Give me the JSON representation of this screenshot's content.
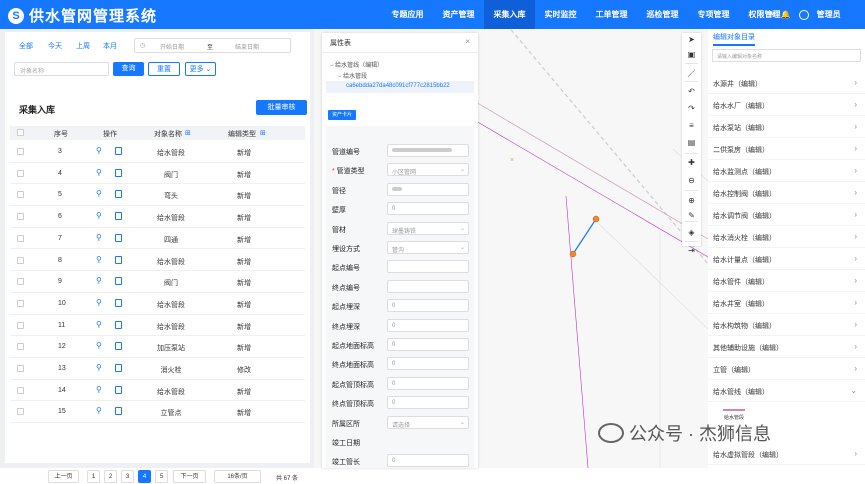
{
  "app": {
    "title": "供水管网管理系统",
    "logo_letter": "S"
  },
  "nav": {
    "items": [
      "专题应用",
      "资产管理",
      "采集入库",
      "实时监控",
      "工单管理",
      "巡检管理",
      "专项管理",
      "权限管理"
    ],
    "active": "采集入库"
  },
  "header": {
    "user": "管理员",
    "bell": "🔔",
    "mail": "✉"
  },
  "filter": {
    "quick": [
      "全部",
      "今天",
      "上周",
      "本月"
    ],
    "date_start_placeholder": "开始日期",
    "date_sep": "至",
    "date_end_placeholder": "结束日期",
    "name_placeholder": "对象名称",
    "search_btn": "查询",
    "reset_btn": "重置",
    "more_btn": "更多"
  },
  "list": {
    "title": "采集入库",
    "batch_btn": "批量审核",
    "headers": [
      "序号",
      "操作",
      "对象名称",
      "编辑类型"
    ],
    "rows": [
      {
        "no": "3",
        "name": "给水管段",
        "type": "新增"
      },
      {
        "no": "4",
        "name": "阀门",
        "type": "新增"
      },
      {
        "no": "5",
        "name": "弯头",
        "type": "新增"
      },
      {
        "no": "6",
        "name": "给水管段",
        "type": "新增"
      },
      {
        "no": "7",
        "name": "四通",
        "type": "新增"
      },
      {
        "no": "8",
        "name": "给水管段",
        "type": "新增"
      },
      {
        "no": "9",
        "name": "阀门",
        "type": "新增"
      },
      {
        "no": "10",
        "name": "给水管段",
        "type": "新增"
      },
      {
        "no": "11",
        "name": "给水管段",
        "type": "新增"
      },
      {
        "no": "12",
        "name": "加压泵站",
        "type": "新增"
      },
      {
        "no": "13",
        "name": "消火栓",
        "type": "修改"
      },
      {
        "no": "14",
        "name": "给水管段",
        "type": "新增"
      },
      {
        "no": "15",
        "name": "立管点",
        "type": "新增"
      }
    ],
    "pager": {
      "prev": "上一页",
      "pages": [
        "1",
        "2",
        "3",
        "4",
        "5"
      ],
      "current": "4",
      "next": "下一页",
      "size": "16条/页",
      "total": "共 67 条"
    }
  },
  "props": {
    "title": "属性表",
    "close": "×",
    "tree_root": "给水管线（编辑）",
    "tree_child": "给水管段",
    "uuid": "ca6ebdda27da48c091cf777c2815bb22",
    "tab": "资产卡片",
    "fields": [
      {
        "label": "管道编号",
        "value": "",
        "required": false,
        "select": false,
        "blur": 60
      },
      {
        "label": "管道类型",
        "value": "小区管网",
        "required": true,
        "select": true
      },
      {
        "label": "管径",
        "value": "",
        "required": false,
        "select": false,
        "blur": 10
      },
      {
        "label": "壁厚",
        "value": "0",
        "required": false,
        "select": false
      },
      {
        "label": "管材",
        "value": "球墨铸铁",
        "required": false,
        "select": true
      },
      {
        "label": "埋设方式",
        "value": "管沟",
        "required": false,
        "select": true
      },
      {
        "label": "起点编号",
        "value": "",
        "required": false,
        "select": false
      },
      {
        "label": "终点编号",
        "value": "",
        "required": false,
        "select": false
      },
      {
        "label": "起点埋深",
        "value": "0",
        "required": false,
        "select": false
      },
      {
        "label": "终点埋深",
        "value": "0",
        "required": false,
        "select": false
      },
      {
        "label": "起点地面标高",
        "value": "0",
        "required": false,
        "select": false
      },
      {
        "label": "终点地面标高",
        "value": "0",
        "required": false,
        "select": false
      },
      {
        "label": "起点管顶标高",
        "value": "0",
        "required": false,
        "select": false
      },
      {
        "label": "终点管顶标高",
        "value": "0",
        "required": false,
        "select": false
      },
      {
        "label": "所属区所",
        "value": "请选择",
        "required": false,
        "select": true
      },
      {
        "label": "竣工日期",
        "value": "",
        "required": false,
        "select": false,
        "none": true
      },
      {
        "label": "竣工管长",
        "value": "0",
        "required": false,
        "select": false
      }
    ]
  },
  "tools": [
    "➤",
    "▣",
    "／",
    "↶",
    "↷",
    "≡",
    "▤",
    "✚",
    "⊖",
    "⊕",
    "✎",
    "◈",
    "⇥"
  ],
  "right": {
    "title": "编辑对象目录",
    "search_placeholder": "请输入编辑对象名称",
    "items": [
      "水源井（编辑）",
      "给水水厂（编辑）",
      "给水泵站（编辑）",
      "二供泵房（编辑）",
      "给水监测点（编辑）",
      "给水控制阀（编辑）",
      "给水调节阀（编辑）",
      "给水消火栓（编辑）",
      "给水计量点（编辑）",
      "给水管件（编辑）",
      "给水井室（编辑）",
      "给水构筑物（编辑）",
      "其他辅助设施（编辑）",
      "立管（编辑）",
      "给水管线（编辑）"
    ],
    "sub_item": "给水管段",
    "last_item": "给水虚拟管段（编辑）"
  },
  "watermark": "公众号 · 杰狮信息"
}
